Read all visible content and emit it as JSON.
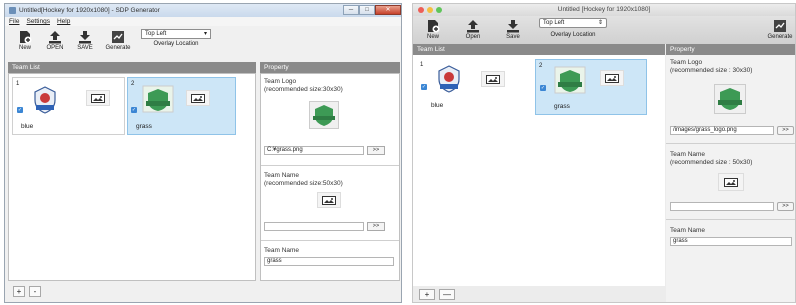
{
  "win": {
    "title": "Untitled[Hockey for 1920x1080] - SDP Generator",
    "ctrl_min": "─",
    "ctrl_max": "□",
    "ctrl_close": "✕",
    "menu": [
      "File",
      "Settings",
      "Help"
    ],
    "toolbar": {
      "new": "New",
      "open": "OPEN",
      "save": "SAVE",
      "generate": "Generate"
    },
    "overlay": {
      "value": "Top Left",
      "label": "Overlay Location"
    },
    "team_list_header": "Team List",
    "property_header": "Property",
    "teams": [
      {
        "index": "1",
        "name": "blue",
        "checked": true
      },
      {
        "index": "2",
        "name": "grass",
        "checked": true
      }
    ],
    "prop": {
      "logo_label": "Team Logo\n(recommended size:30x30)",
      "logo_path": "C:¥grass.png",
      "browse": ">>",
      "name_image_label": "Team Name\n(recommended size:50x30)",
      "name_image_path": "",
      "name_label": "Team Name",
      "name_value": "grass"
    },
    "add": "+",
    "remove": "-"
  },
  "mac": {
    "title": "Untitled [Hockey for 1920x1080]",
    "toolbar": {
      "new": "New",
      "open": "Open",
      "save": "Save",
      "generate": "Generate"
    },
    "overlay": {
      "value": "Top Left",
      "label": "Overlay Location"
    },
    "team_list_header": "Team List",
    "property_header": "Property",
    "teams": [
      {
        "index": "1",
        "name": "blue",
        "checked": true
      },
      {
        "index": "2",
        "name": "grass",
        "checked": true
      }
    ],
    "prop": {
      "logo_label": "Team Logo\n(recommended size : 30x30)",
      "logo_path": "/images/grass_logo.png",
      "browse": ">>",
      "name_image_label": "Team Name\n(recommended size : 50x30)",
      "name_image_path": "",
      "name_label": "Team Name",
      "name_value": "grass"
    },
    "add": "+",
    "remove": "—"
  },
  "colors": {
    "selected_card": "#cde6f7",
    "panel_header": "#8a8a8a",
    "checkbox": "#3b86d4"
  },
  "icons": [
    "new-icon",
    "open-icon",
    "save-icon",
    "generate-icon",
    "team-logo-icon",
    "image-icon"
  ]
}
